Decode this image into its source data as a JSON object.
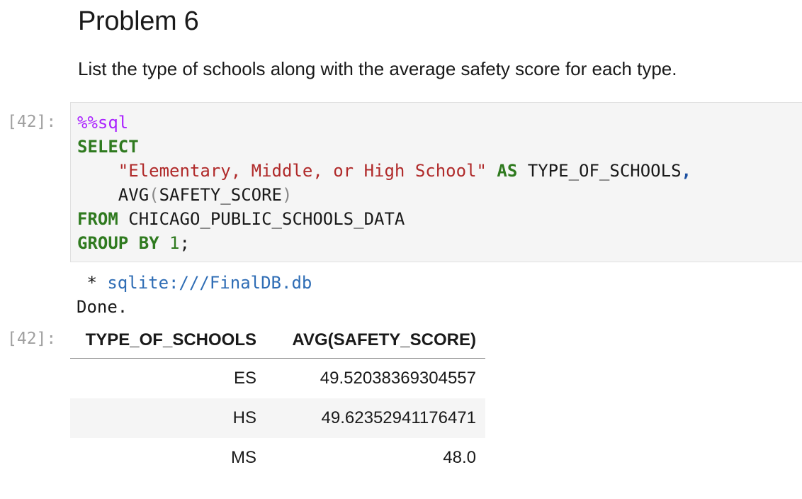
{
  "markdown": {
    "title": "Problem 6",
    "description": "List the type of schools along with the average safety score for each type."
  },
  "cell": {
    "input_prompt": "[42]:",
    "output_prompt": "[42]:",
    "code": {
      "magic": "%%sql",
      "select_kw": "SELECT",
      "string_literal": "\"Elementary, Middle, or High School\"",
      "as_kw": "AS",
      "alias": "TYPE_OF_SCHOOLS",
      "comma": ",",
      "func_name": "AVG",
      "paren_open": "(",
      "func_arg": "SAFETY_SCORE",
      "paren_close": ")",
      "from_kw": "FROM",
      "table_name": "CHICAGO_PUBLIC_SCHOOLS_DATA",
      "group_by_kw": "GROUP BY",
      "group_by_num": "1",
      "semicolon": ";"
    },
    "output": {
      "connection_prefix": " * ",
      "connection": "sqlite:///FinalDB.db",
      "status": "Done."
    }
  },
  "result_table": {
    "headers": [
      "TYPE_OF_SCHOOLS",
      "AVG(SAFETY_SCORE)"
    ],
    "rows": [
      [
        "ES",
        "49.52038369304557"
      ],
      [
        "HS",
        "49.62352941176471"
      ],
      [
        "MS",
        "48.0"
      ]
    ]
  },
  "colors": {
    "keyword": "#2f7a1f",
    "magic": "#aa22ff",
    "string": "#b02a2a",
    "link": "#2f6db5",
    "cell_background": "#f5f5f5"
  }
}
